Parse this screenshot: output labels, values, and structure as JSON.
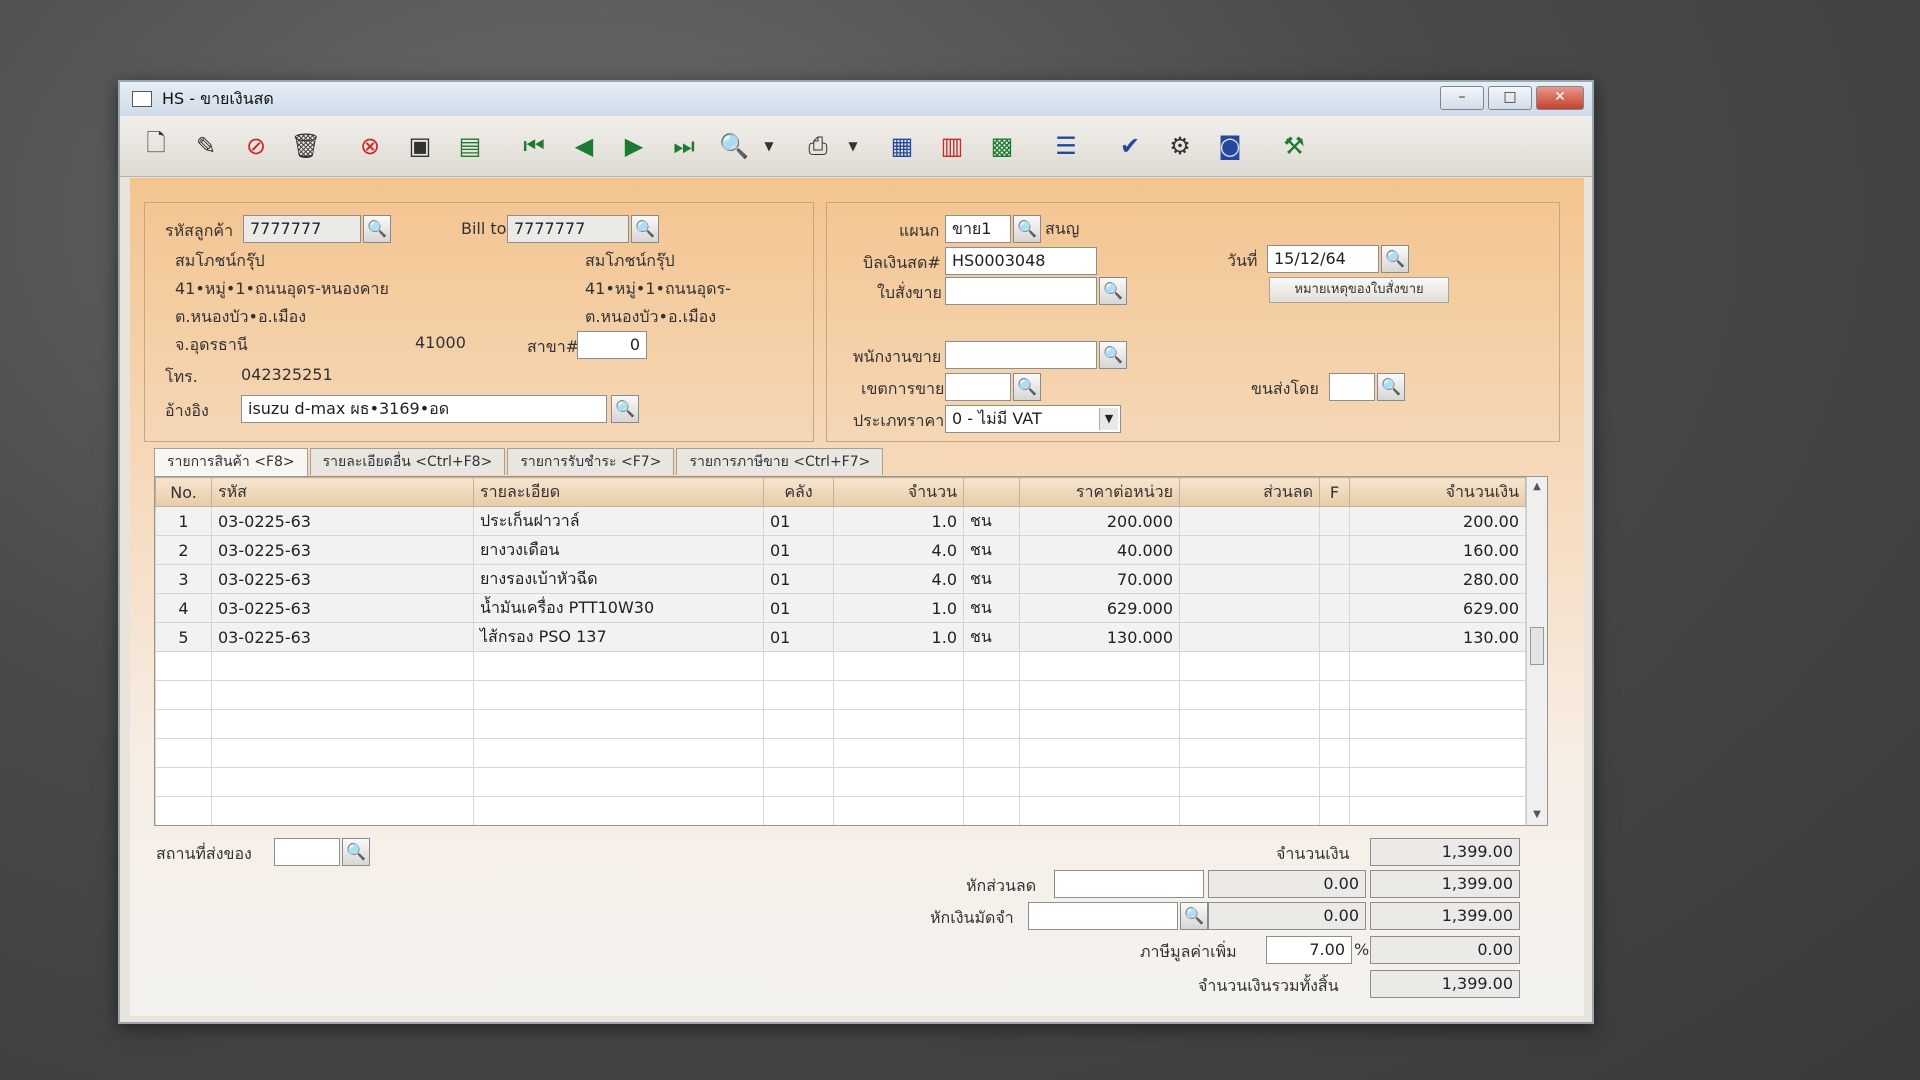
{
  "window": {
    "title": "HS - ขายเงินสด",
    "minimize": "–",
    "maximize": "□",
    "close": "✕"
  },
  "toolbar_icons": [
    "new-doc-icon",
    "edit-icon",
    "void-icon",
    "delete-icon",
    "cancel-icon",
    "save-icon",
    "books-icon",
    "first-record-icon",
    "prev-record-icon",
    "next-record-icon",
    "last-record-icon",
    "preview-icon",
    "print-icon",
    "calculator-icon",
    "form-icon",
    "report-icon",
    "list-icon",
    "approve-icon",
    "tools-icon",
    "ok-icon",
    "settings-icon"
  ],
  "customer": {
    "code_label": "รหัสลูกค้า",
    "code": "7777777",
    "bill_to_label": "Bill to",
    "bill_to": "7777777",
    "name": "สมโภชน์กรุ๊ป",
    "addr1": "41•หมู่•1•ถนนอุดร-หนองคาย",
    "addr2": "ต.หนองบัว•อ.เมือง",
    "addr3": "จ.อุดรธานี",
    "zip": "41000",
    "bill_name": "สมโภชน์กรุ๊ป",
    "bill_addr1": "41•หมู่•1•ถนนอุดร-",
    "bill_addr2": "ต.หนองบัว•อ.เมือง",
    "branch_label": "สาขา#",
    "branch": "0",
    "phone_label": "โทร.",
    "phone": "042325251",
    "ref_label": "อ้างอิง",
    "ref": "isuzu d-max ผธ•3169•อด"
  },
  "doc": {
    "dept_label": "แผนก",
    "dept": "ขาย1",
    "dept_name": "สนญ",
    "bill_label": "บิลเงินสด#",
    "bill_no": "HS0003048",
    "date_label": "วันที่",
    "date": "15/12/64",
    "so_label": "ใบสั่งขาย",
    "so": "",
    "note_button": "หมายเหตุของใบสั่งขาย",
    "salesman_label": "พนักงานขาย",
    "salesman": "",
    "area_label": "เขตการขาย",
    "area": "",
    "shipby_label": "ขนส่งโดย",
    "shipby": "",
    "pricetype_label": "ประเภทราคา",
    "pricetype": "0 - ไม่มี VAT"
  },
  "tabs": [
    "รายการสินค้า <F8>",
    "รายละเอียดอื่น <Ctrl+F8>",
    "รายการรับชำระ <F7>",
    "รายการภาษีขาย <Ctrl+F7>"
  ],
  "grid": {
    "headers": [
      "No.",
      "รหัส",
      "รายละเอียด",
      "คลัง",
      "จำนวน",
      "",
      "ราคาต่อหน่วย",
      "ส่วนลด",
      "F",
      "จำนวนเงิน"
    ],
    "rows": [
      [
        "1",
        "03-0225-63",
        "ประเก็นฝาวาล์",
        "01",
        "1.0",
        "ชน",
        "200.000",
        "",
        "",
        "200.00"
      ],
      [
        "2",
        "03-0225-63",
        "ยางวงเดือน",
        "01",
        "4.0",
        "ชน",
        "40.000",
        "",
        "",
        "160.00"
      ],
      [
        "3",
        "03-0225-63",
        "ยางรองเบ้าหัวฉีด",
        "01",
        "4.0",
        "ชน",
        "70.000",
        "",
        "",
        "280.00"
      ],
      [
        "4",
        "03-0225-63",
        "น้ำมันเครื่อง PTT10W30",
        "01",
        "1.0",
        "ชน",
        "629.000",
        "",
        "",
        "629.00"
      ],
      [
        "5",
        "03-0225-63",
        "ไส้กรอง PSO 137",
        "01",
        "1.0",
        "ชน",
        "130.000",
        "",
        "",
        "130.00"
      ]
    ]
  },
  "totals": {
    "ship_label": "สถานที่ส่งของ",
    "ship": "",
    "amount_label": "จำนวนเงิน",
    "amount": "1,399.00",
    "discount_label": "หักส่วนลด",
    "discount_input": "",
    "discount_value": "0.00",
    "after_discount": "1,399.00",
    "deposit_label": "หักเงินมัดจำ",
    "deposit_input": "",
    "deposit_value": "0.00",
    "after_deposit": "1,399.00",
    "vat_label": "ภาษีมูลค่าเพิ่ม",
    "vat_rate": "7.00",
    "vat_pct": "%",
    "vat_value": "0.00",
    "grand_label": "จำนวนเงินรวมทั้งสิ้น",
    "grand_total": "1,399.00"
  }
}
